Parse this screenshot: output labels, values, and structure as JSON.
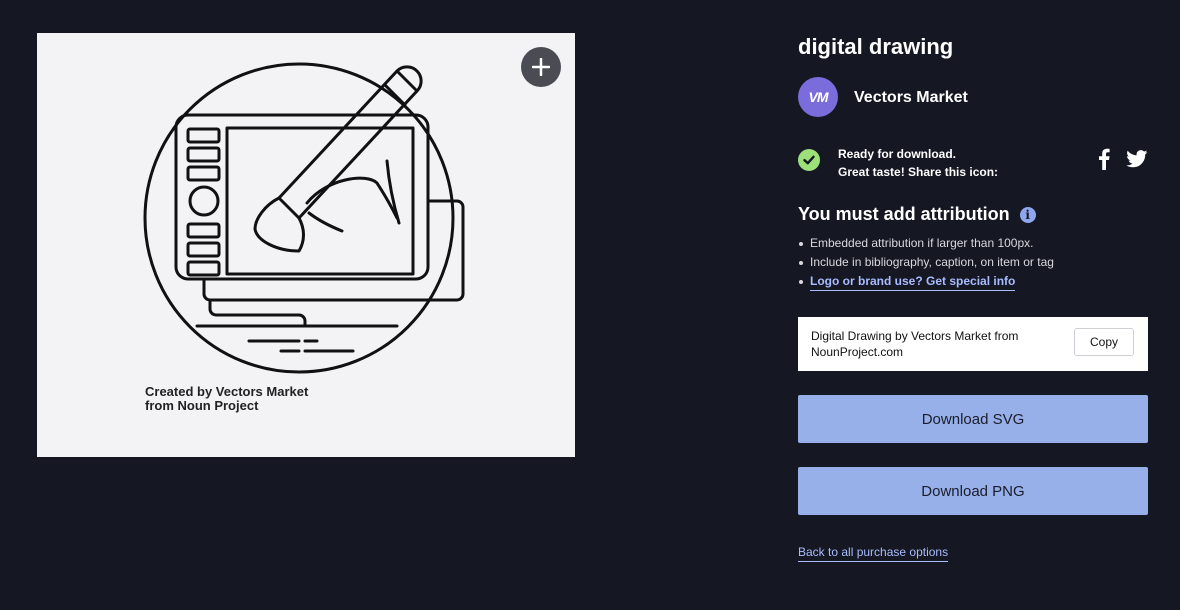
{
  "preview": {
    "icon_name": "digital-drawing-tablet-illustration",
    "credit_line1": "Created by Vectors Market",
    "credit_line2": "from Noun Project",
    "add_icon": "plus-icon"
  },
  "icon": {
    "title": "digital drawing"
  },
  "author": {
    "avatar_text": "VM",
    "name": "Vectors Market",
    "avatar_color": "#7b6cdb"
  },
  "status": {
    "line1": "Ready for download.",
    "line2": "Great taste! Share this icon:",
    "check_color": "#9ce07a"
  },
  "share": {
    "facebook_icon": "facebook-icon",
    "twitter_icon": "twitter-icon"
  },
  "attribution": {
    "heading": "You must add attribution",
    "info_glyph": "i",
    "items": [
      "Embedded attribution if larger than 100px.",
      "Include in bibliography, caption, on item or tag"
    ],
    "special_link": "Logo or brand use? Get special info",
    "text": "Digital Drawing by Vectors Market from NounProject.com",
    "copy_label": "Copy"
  },
  "downloads": {
    "svg_label": "Download SVG",
    "png_label": "Download PNG",
    "button_color": "#97b0ea"
  },
  "back_link": "Back to all purchase options",
  "colors": {
    "background": "#151722",
    "link": "#a8bcff"
  }
}
